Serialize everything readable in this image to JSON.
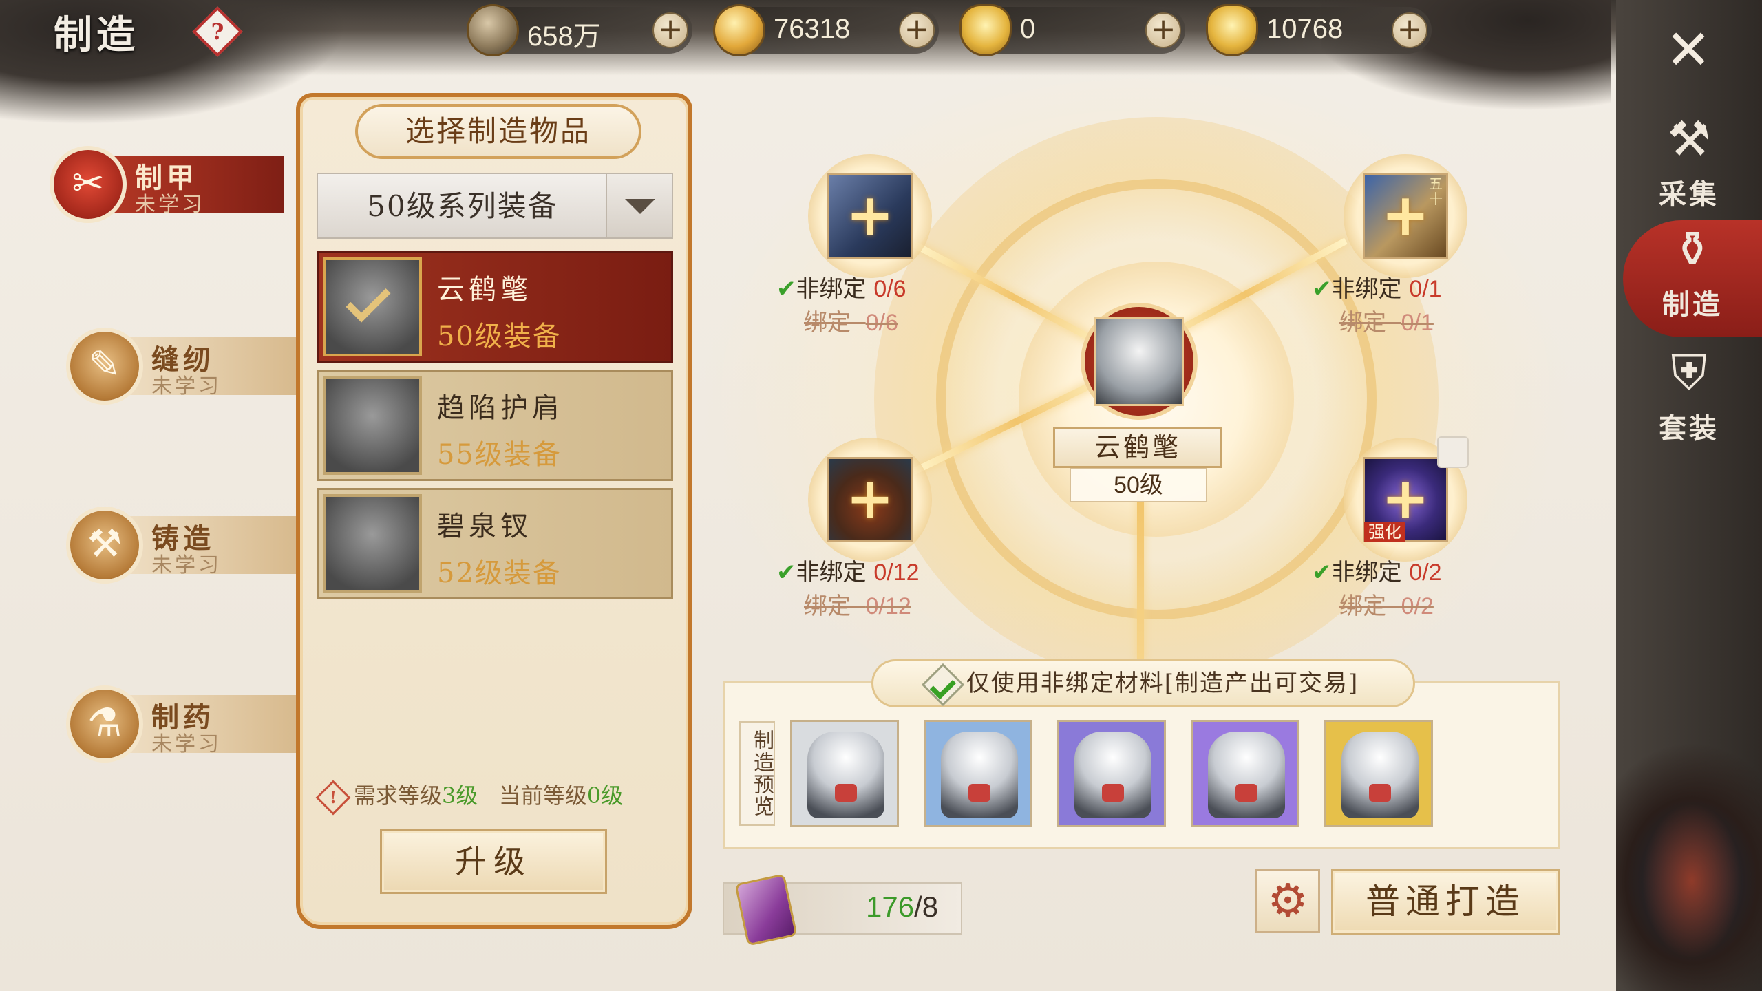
{
  "header": {
    "title": "制造",
    "help_label": "?",
    "currencies": [
      {
        "icon": "copper-coin-icon",
        "value": "658万"
      },
      {
        "icon": "gold-coin-icon",
        "value": "76318"
      },
      {
        "icon": "bound-ingot-icon",
        "value": "0"
      },
      {
        "icon": "gold-ingot-icon",
        "value": "10768"
      }
    ],
    "plus_label": "+"
  },
  "right_tabs": [
    {
      "label": "采集",
      "icon": "gather-tools-icon",
      "active": false
    },
    {
      "label": "制造",
      "icon": "mortar-craft-icon",
      "active": true
    },
    {
      "label": "套装",
      "icon": "armor-set-icon",
      "active": false
    }
  ],
  "close_label": "✕",
  "left_tabs": [
    {
      "name": "制甲",
      "status": "未学习",
      "icon": "scissors-icon",
      "active": true
    },
    {
      "name": "缝纫",
      "status": "未学习",
      "icon": "scroll-cloth-icon",
      "active": false
    },
    {
      "name": "铸造",
      "status": "未学习",
      "icon": "hammer-icon",
      "active": false
    },
    {
      "name": "制药",
      "status": "未学习",
      "icon": "mortar-icon",
      "active": false
    }
  ],
  "panel": {
    "title": "选择制造物品",
    "dropdown_value": "50级系列装备",
    "items": [
      {
        "name": "云鹤氅",
        "level": "50级装备",
        "selected": true
      },
      {
        "name": "趋陷护肩",
        "level": "55级装备",
        "selected": false
      },
      {
        "name": "碧泉钗",
        "level": "52级装备",
        "selected": false
      }
    ],
    "req_prefix": "需求等级",
    "req_value": "3级",
    "cur_prefix": "当前等级",
    "cur_value": "0级",
    "upgrade_label": "升级"
  },
  "craft": {
    "center_name": "云鹤氅",
    "center_level": "50级",
    "materials": [
      {
        "icon": "ore-stone-icon",
        "unbound_label": "非绑定",
        "unbound": "0/6",
        "bound_label": "绑定",
        "bound": "0/6",
        "tag": ""
      },
      {
        "icon": "scroll-map-icon",
        "unbound_label": "非绑定",
        "unbound": "0/1",
        "bound_label": "绑定",
        "bound": "0/1",
        "tag": ""
      },
      {
        "icon": "bowl-icon",
        "unbound_label": "非绑定",
        "unbound": "0/12",
        "bound_label": "绑定",
        "bound": "0/12",
        "tag": ""
      },
      {
        "icon": "orb-stone-icon",
        "unbound_label": "非绑定",
        "unbound": "0/2",
        "bound_label": "绑定",
        "bound": "0/2",
        "tag": "强化"
      }
    ],
    "check_mark": "✔",
    "plus": "+",
    "scroll_corner_text": "五十",
    "preview_banner": "仅使用非绑定材料[制造产出可交易]",
    "preview_label": "制造预览",
    "preview_colors": [
      "#d9dcdf",
      "#8fb4e0",
      "#8a7ad8",
      "#9a7ae0",
      "#e6c04a"
    ],
    "stamina_current": "176",
    "stamina_sep_cost": "/8",
    "gear_icon": "⚙",
    "craft_button": "普通打造"
  }
}
